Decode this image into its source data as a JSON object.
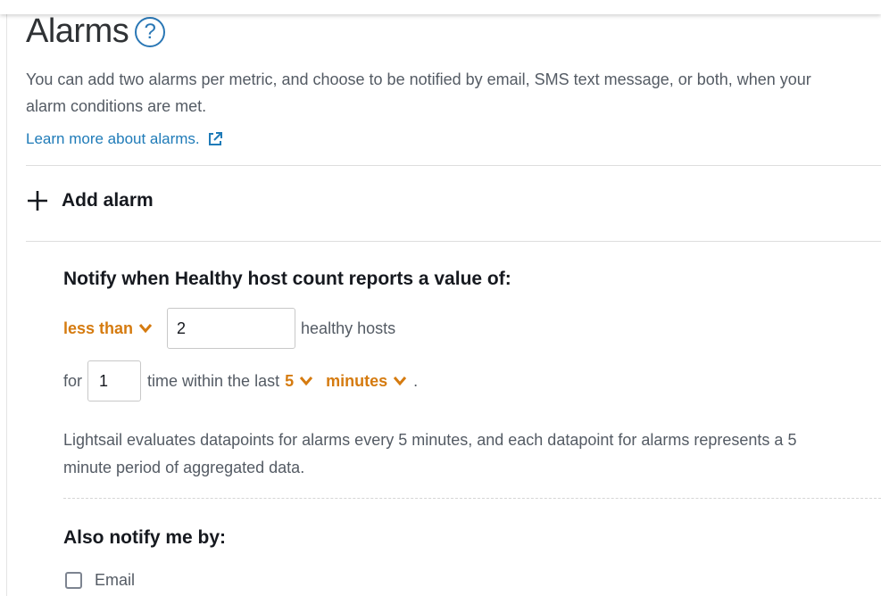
{
  "header": {
    "title": "Alarms",
    "help_glyph": "?",
    "description": "You can add two alarms per metric, and choose to be notified by email, SMS text message, or both, when your alarm conditions are met.",
    "learn_more": "Learn more about alarms."
  },
  "add_alarm": {
    "label": "Add alarm"
  },
  "condition": {
    "title": "Notify when Healthy host count reports a value of:",
    "operator": "less than",
    "threshold": "2",
    "threshold_suffix": "healthy hosts",
    "for_label": "for",
    "datapoints": "1",
    "within_label": "time within the last",
    "evaluation_periods": "5",
    "period_unit": "minutes",
    "period_end": ".",
    "note": "Lightsail evaluates datapoints for alarms every 5 minutes, and each datapoint for alarms represents a 5 minute period of aggregated data."
  },
  "notify": {
    "title": "Also notify me by:",
    "email_label": "Email",
    "email_checked": false
  },
  "icons": {
    "help": "question-circle-icon",
    "external": "external-link-icon",
    "add": "plus-icon",
    "dropdown": "chevron-down-icon"
  },
  "colors": {
    "accent_orange": "#d57b10",
    "link_blue": "#1f7bb8",
    "text_dark": "#16191f",
    "text_muted": "#545b64"
  }
}
